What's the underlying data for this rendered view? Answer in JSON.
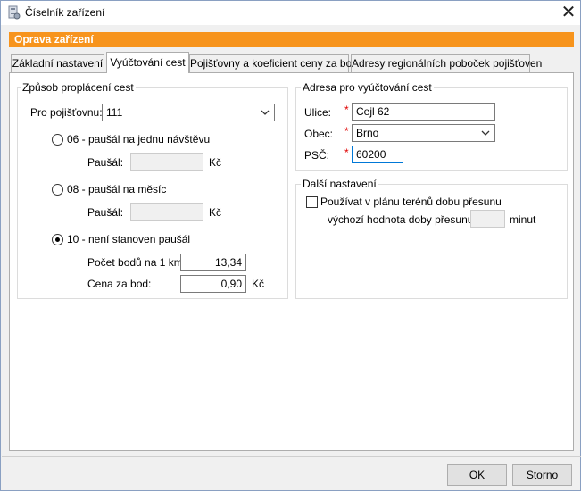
{
  "window": {
    "title": "Číselník zařízení"
  },
  "header": {
    "title": "Oprava zařízení"
  },
  "tabs": [
    {
      "label": "Základní nastavení"
    },
    {
      "label": "Vyúčtování cest"
    },
    {
      "label": "Pojišťovny a koeficient ceny za bod"
    },
    {
      "label": "Adresy regionálních poboček pojišťoven"
    }
  ],
  "payment": {
    "caption": "Způsob proplácení cest",
    "insurer_label": "Pro pojišťovnu:",
    "insurer_value": "111",
    "option06": {
      "label": "06 - paušál na jednu návštěvu",
      "flat_label": "Paušál:",
      "flat_value": "",
      "currency": "Kč"
    },
    "option08": {
      "label": "08 - paušál na měsíc",
      "flat_label": "Paušál:",
      "flat_value": "",
      "currency": "Kč"
    },
    "option10": {
      "label": "10 - není stanoven paušál",
      "points_label": "Počet bodů na 1 km:",
      "points_value": "13,34",
      "price_label": "Cena za bod:",
      "price_value": "0,90",
      "currency": "Kč"
    },
    "selected": "10"
  },
  "address": {
    "caption": "Adresa pro vyúčtování cest",
    "street_label": "Ulice:",
    "street_value": "Cejl 62",
    "city_label": "Obec:",
    "city_value": "Brno",
    "zip_label": "PSČ:",
    "zip_value": "60200",
    "required_mark": "*"
  },
  "other": {
    "caption": "Další nastavení",
    "travel_time_label": "Používat v plánu terénů dobu přesunu",
    "travel_time_checked": false,
    "default_label": "výchozí hodnota doby přesunu:",
    "default_value": "",
    "unit": "minut"
  },
  "footer": {
    "ok_label": "OK",
    "cancel_label": "Storno"
  },
  "colors": {
    "accent": "#f7941d",
    "required": "#e00000",
    "focus": "#0078d7"
  }
}
